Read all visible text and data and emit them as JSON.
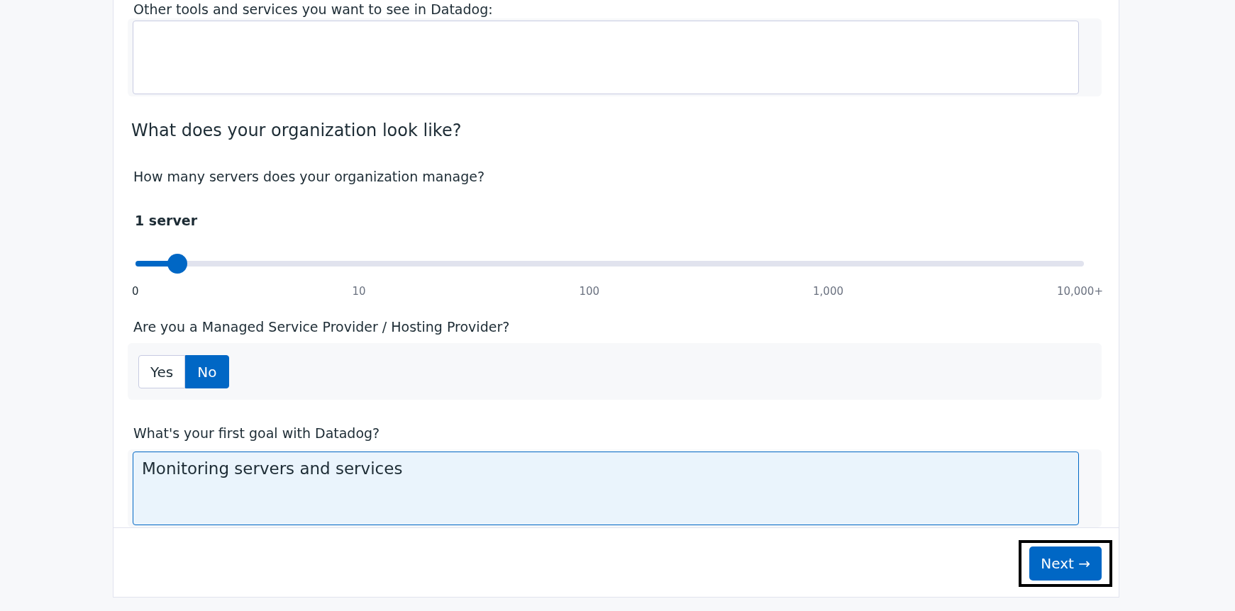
{
  "tools_question": {
    "label": "Other tools and services you want to see in Datadog:"
  },
  "section_title": "What does your organization look like?",
  "servers": {
    "label": "How many servers does your organization manage?",
    "reading": "1 server",
    "level": 0.044,
    "ticks": [
      "0",
      "10",
      "100",
      "1,000",
      "10,000+"
    ]
  },
  "msp": {
    "label": "Are you a Managed Service Provider / Hosting Provider?",
    "options": [
      {
        "label": "Yes",
        "selected": false
      },
      {
        "label": "No",
        "selected": true
      }
    ]
  },
  "goal": {
    "label": "What's your first goal with Datadog?",
    "value": "Monitoring servers and services",
    "focused": true
  },
  "next_button": {
    "label": "Next →",
    "highlighted": true
  }
}
